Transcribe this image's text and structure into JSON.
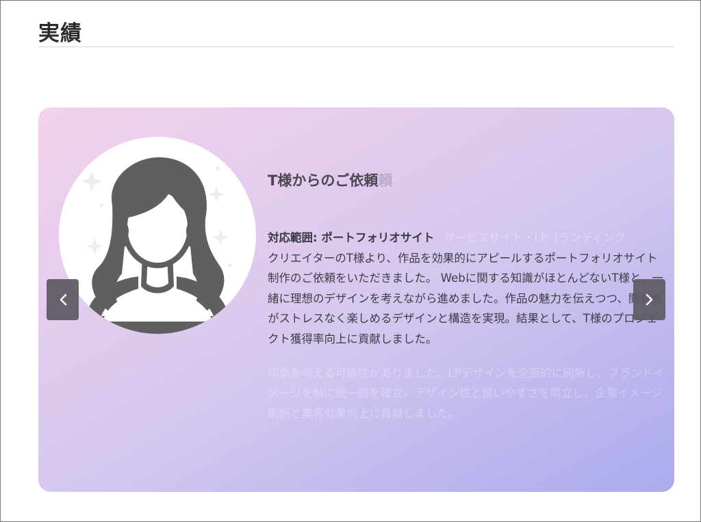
{
  "section": {
    "title": "実績"
  },
  "slide": {
    "title": "T様からのご依頼",
    "title_ghost": "頼",
    "scope": "対応範囲: ポートフォリオサイト",
    "scope_ghost": "サービスサイト・LP（ランディング",
    "description": "クリエイターのT様より、作品を効果的にアピールするポートフォリオサイト制作のご依頼をいただきました。 Webに関する知識がほとんどないT様と、一緒に理想のデザインを考えながら進めました。作品の魅力を伝えつつ、閲覧者がストレスなく楽しめるデザインと構造を実現。結果として、T様のプロジェクト獲得率向上に貢献しました。",
    "ghost_description": "印象を与える可能性がありました。LPデザインを全面的に刷新し、ブランドイメージを軸に統一感を確立。デザイン性と使いやすさを両立し、企業イメージ刷新と集客効果向上に貢献しました。"
  },
  "navigation": {
    "prev_icon": "chevron-left-icon",
    "next_icon": "chevron-right-icon"
  },
  "colors": {
    "gradient_start": "#f4d1ea",
    "gradient_end": "#ababef",
    "nav_button": "#5e5a63",
    "avatar_fill": "#5f5f5f"
  }
}
